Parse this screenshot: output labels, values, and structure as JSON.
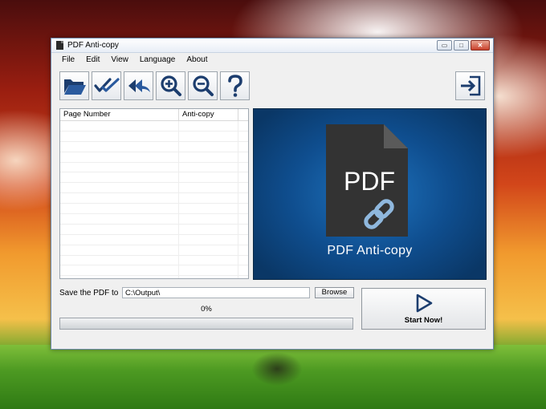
{
  "window": {
    "title": "PDF Anti-copy",
    "controls": {
      "minimize": "▭",
      "maximize": "□",
      "close": "✕"
    }
  },
  "menu": {
    "items": [
      "File",
      "Edit",
      "View",
      "Language",
      "About"
    ]
  },
  "toolbar": {
    "buttons": [
      {
        "icon": "open-folder-icon"
      },
      {
        "icon": "check-all-icon"
      },
      {
        "icon": "undo-all-icon"
      },
      {
        "icon": "zoom-in-icon"
      },
      {
        "icon": "zoom-out-icon"
      },
      {
        "icon": "help-icon"
      }
    ],
    "exit_icon": "exit-icon"
  },
  "table": {
    "columns": [
      "Page Number",
      "Anti-copy"
    ],
    "rows": []
  },
  "preview": {
    "doc_label": "PDF",
    "title": "PDF Anti-copy",
    "colors": {
      "bg": "#1565ae",
      "doc": "#333333",
      "link": "#8fb8de"
    }
  },
  "output": {
    "save_label": "Save the PDF to",
    "path": "C:\\Output\\",
    "browse_label": "Browse"
  },
  "progress": {
    "percent_text": "0%",
    "value": 0
  },
  "start": {
    "label": "Start Now!"
  }
}
